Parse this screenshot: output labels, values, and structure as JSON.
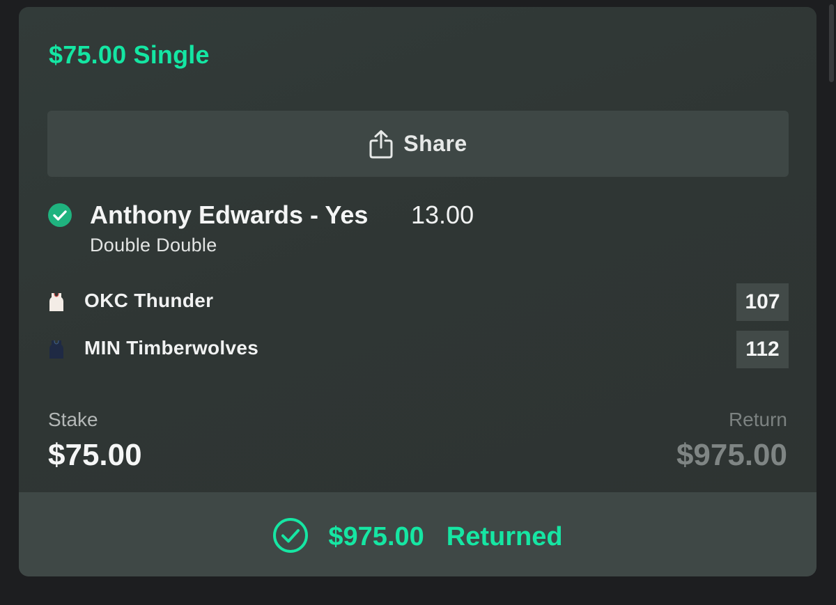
{
  "bet": {
    "title": "$75.00 Single"
  },
  "share": {
    "label": "Share",
    "icon": "share-icon"
  },
  "selection": {
    "name": "Anthony Edwards - Yes",
    "odds": "13.00",
    "market": "Double Double",
    "status_icon": "check-circle-icon"
  },
  "teams": [
    {
      "name": "OKC Thunder",
      "score": "107",
      "jersey_icon": "jersey-icon",
      "jersey_color": "#f3ece6"
    },
    {
      "name": "MIN Timberwolves",
      "score": "112",
      "jersey_icon": "jersey-icon",
      "jersey_color": "#1f2a44"
    }
  ],
  "stake": {
    "label": "Stake",
    "value": "$75.00"
  },
  "return": {
    "label": "Return",
    "value": "$975.00"
  },
  "result": {
    "amount": "$975.00",
    "status": "Returned",
    "icon": "check-circle-outline-icon"
  },
  "colors": {
    "accent": "#14e6a3",
    "check_fill": "#1fb37f"
  }
}
